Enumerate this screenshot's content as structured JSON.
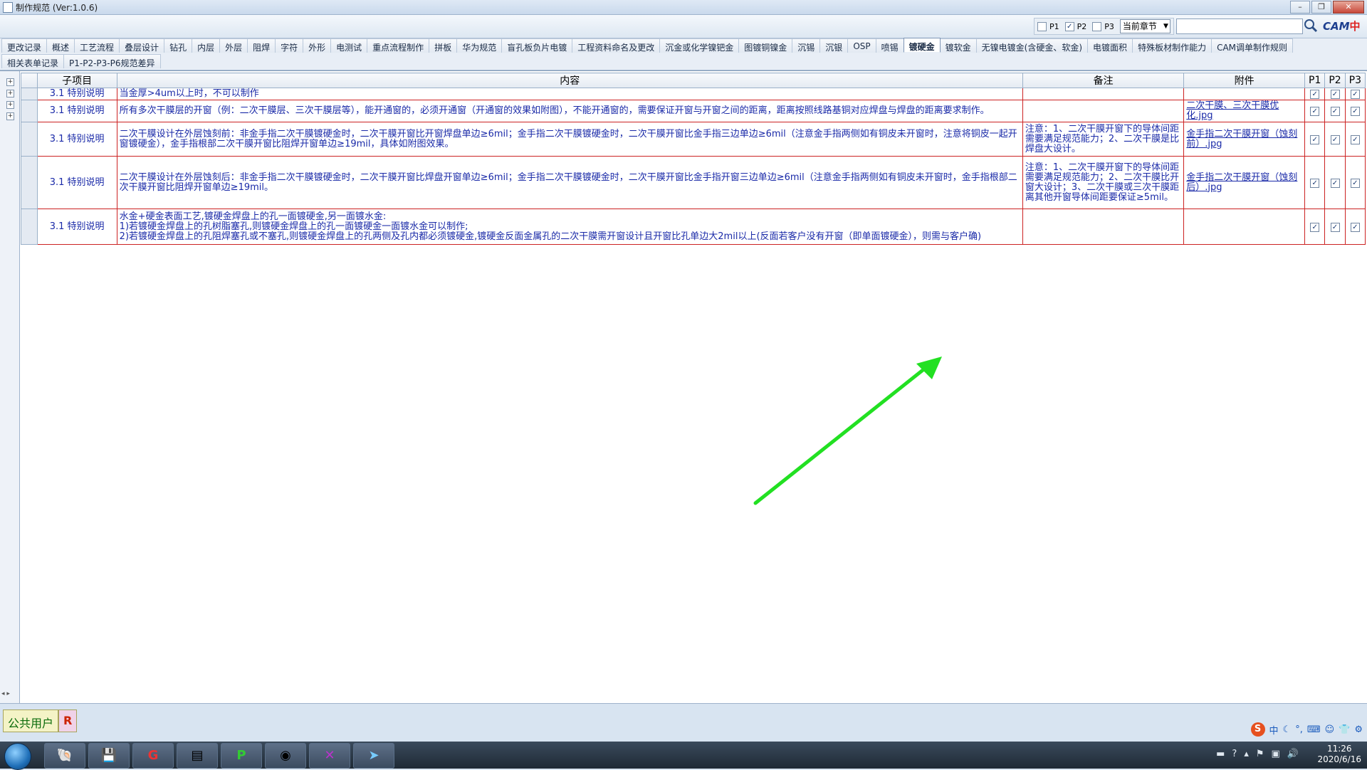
{
  "window": {
    "title": "制作规范 (Ver:1.0.6)"
  },
  "toolbar": {
    "filters": [
      {
        "label": "P1",
        "checked": false
      },
      {
        "label": "P2",
        "checked": true
      },
      {
        "label": "P3",
        "checked": false
      }
    ],
    "scope_selected": "当前章节",
    "search_value": "",
    "logo_text": "CAM",
    "logo_sub": "中心"
  },
  "tabs": {
    "row1": [
      "更改记录",
      "概述",
      "工艺流程",
      "叠层设计",
      "钻孔",
      "内层",
      "外层",
      "阻焊",
      "字符",
      "外形",
      "电测试",
      "重点流程制作",
      "拼板",
      "华为规范",
      "盲孔板负片电镀",
      "工程资料命名及更改",
      "沉金或化学镍钯金",
      "图镀铜镍金",
      "沉锡",
      "沉银",
      "OSP",
      "喷锡",
      "镀硬金",
      "镀软金",
      "无镍电镀金(含硬金、软金)",
      "电镀面积",
      "特殊板材制作能力",
      "CAM调单制作规则"
    ],
    "row2": [
      "相关表单记录",
      "P1-P2-P3-P6规范差异"
    ],
    "active": "镀硬金"
  },
  "grid": {
    "headers": {
      "sub": "子项目",
      "content": "内容",
      "remark": "备注",
      "attach": "附件",
      "p1": "P1",
      "p2": "P2",
      "p3": "P3"
    },
    "rows": [
      {
        "section": "3.1 特别说明",
        "content": "当金厚>4um以上时，不可以制作",
        "remark": "",
        "attachment": "",
        "p1": true,
        "p2": true,
        "p3": true
      },
      {
        "section": "3.1 特别说明",
        "content": "所有多次干膜层的开窗（例：二次干膜层、三次干膜层等），能开通窗的，必须开通窗（开通窗的效果如附图），不能开通窗的，需要保证开窗与开窗之间的距离，距离按照线路基铜对应焊盘与焊盘的距离要求制作。",
        "remark": "",
        "attachment": "二次干膜、三次干膜优化.jpg",
        "p1": true,
        "p2": true,
        "p3": true
      },
      {
        "section": "3.1 特别说明",
        "content": "二次干膜设计在外层蚀刻前：非金手指二次干膜镀硬金时，二次干膜开窗比开窗焊盘单边≥6mil；金手指二次干膜镀硬金时，二次干膜开窗比金手指三边单边≥6mil（注意金手指两侧如有铜皮未开窗时，注意将铜皮一起开窗镀硬金），金手指根部二次干膜开窗比阻焊开窗单边≥19mil，具体如附图效果。",
        "remark": "注意：1、二次干膜开窗下的导体间距需要满足规范能力；2、二次干膜是比焊盘大设计。",
        "attachment": "金手指二次干膜开窗（蚀刻前）.jpg",
        "p1": true,
        "p2": true,
        "p3": true
      },
      {
        "section": "3.1 特别说明",
        "content": "二次干膜设计在外层蚀刻后：非金手指二次干膜镀硬金时，二次干膜开窗比焊盘开窗单边≥6mil；金手指二次干膜镀硬金时，二次干膜开窗比金手指开窗三边单边≥6mil（注意金手指两侧如有铜皮未开窗时，金手指根部二次干膜开窗比阻焊开窗单边≥19mil。",
        "remark": "注意：1、二次干膜开窗下的导体间距需要满足规范能力；2、二次干膜比开窗大设计；3、二次干膜或三次干膜距离其他开窗导体间距要保证≥5mil。",
        "attachment": "金手指二次干膜开窗（蚀刻后）.jpg",
        "p1": true,
        "p2": true,
        "p3": true
      },
      {
        "section": "3.1 特别说明",
        "content": "水金+硬金表面工艺,镀硬金焊盘上的孔一面镀硬金,另一面镀水金:\n1)若镀硬金焊盘上的孔树脂塞孔,则镀硬金焊盘上的孔一面镀硬金一面镀水金可以制作;\n2)若镀硬金焊盘上的孔阻焊塞孔或不塞孔,则镀硬金焊盘上的孔两侧及孔内都必须镀硬金,镀硬金反面金属孔的二次干膜需开窗设计且开窗比孔单边大2mil以上(反面若客户没有开窗（即单面镀硬金），则需与客户确)",
        "remark": "",
        "attachment": "",
        "p1": true,
        "p2": true,
        "p3": true
      }
    ]
  },
  "status": {
    "user": "公共用户",
    "role": "R",
    "ime": [
      "中",
      "ﾞ",
      "⁺",
      "⌨",
      "☺",
      "👕",
      "⚙"
    ]
  },
  "taskbar": {
    "time": "11:26",
    "date": "2020/6/16"
  },
  "colors": {
    "grid_text": "#1a2aa8",
    "grid_border": "#cc2222",
    "arrow": "#22e022"
  }
}
